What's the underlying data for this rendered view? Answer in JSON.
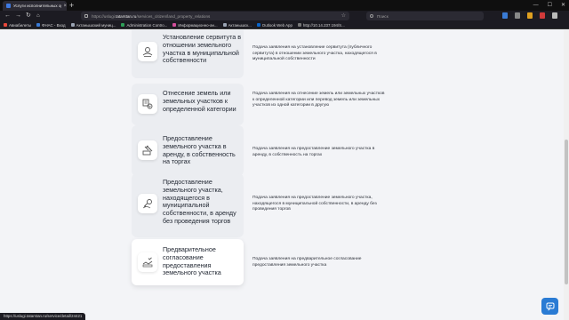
{
  "browser": {
    "tab_title": "Услуги исполнительных органов Республики...",
    "url_prefix": "https://uslugi.",
    "url_domain": "tatarstan.ru",
    "url_path": "/services_citizen/land_property_relations",
    "search_placeholder": "Поиск",
    "status_url": "https://uslugi.tatarstan.ru/service/detail/24421"
  },
  "bookmarks": [
    {
      "label": "Авиабилеты",
      "color": "#e8483b"
    },
    {
      "label": "ФНАС - Вход",
      "color": "#3a7bd5"
    },
    {
      "label": "Актанышский муниц...",
      "color": "#9aa3b2"
    },
    {
      "label": "Administration Contro...",
      "color": "#2e9e57"
    },
    {
      "label": "Информационно-ан...",
      "color": "#d14e9a"
    },
    {
      "label": "Актанышск...",
      "color": "#9aa3b2"
    },
    {
      "label": "Outlook Web App",
      "color": "#0a64c9"
    },
    {
      "label": "http://10.14.237.194/S...",
      "color": "#777777"
    }
  ],
  "services": [
    {
      "title": "Установление сервитута в отношении земельного участка в муниципальной собственности",
      "description": "Подача заявления на установление сервитута (публичного сервитута) в отношении земельного участка, находящегося в муниципальной собственности",
      "icon": "servitude-icon"
    },
    {
      "title": "Отнесение земель или земельных участков к определенной категории",
      "description": "Подача заявления на отнесение земель или земельных участков к определенной категории или перевод земель или земельных участков из одной категории в другую",
      "icon": "land-category-icon"
    },
    {
      "title": "Предоставление земельного участка в аренду, в собственность на торгах",
      "description": "Подача заявления на предоставление земельного участка в аренду, в собственность на торгах",
      "icon": "auction-icon"
    },
    {
      "title": "Предоставление земельного участка, находящегося в муниципальной собственности, в аренду без проведения торгов",
      "description": "Подача заявления на предоставление земельного участка, находящегося в муниципальной собственности, в аренду без проведения торгов",
      "icon": "land-lease-icon"
    },
    {
      "title": "Предварительное согласование предоставления земельного участка",
      "description": "Подача заявления на предварительное согласование предоставления земельного участка",
      "icon": "approval-icon"
    }
  ]
}
